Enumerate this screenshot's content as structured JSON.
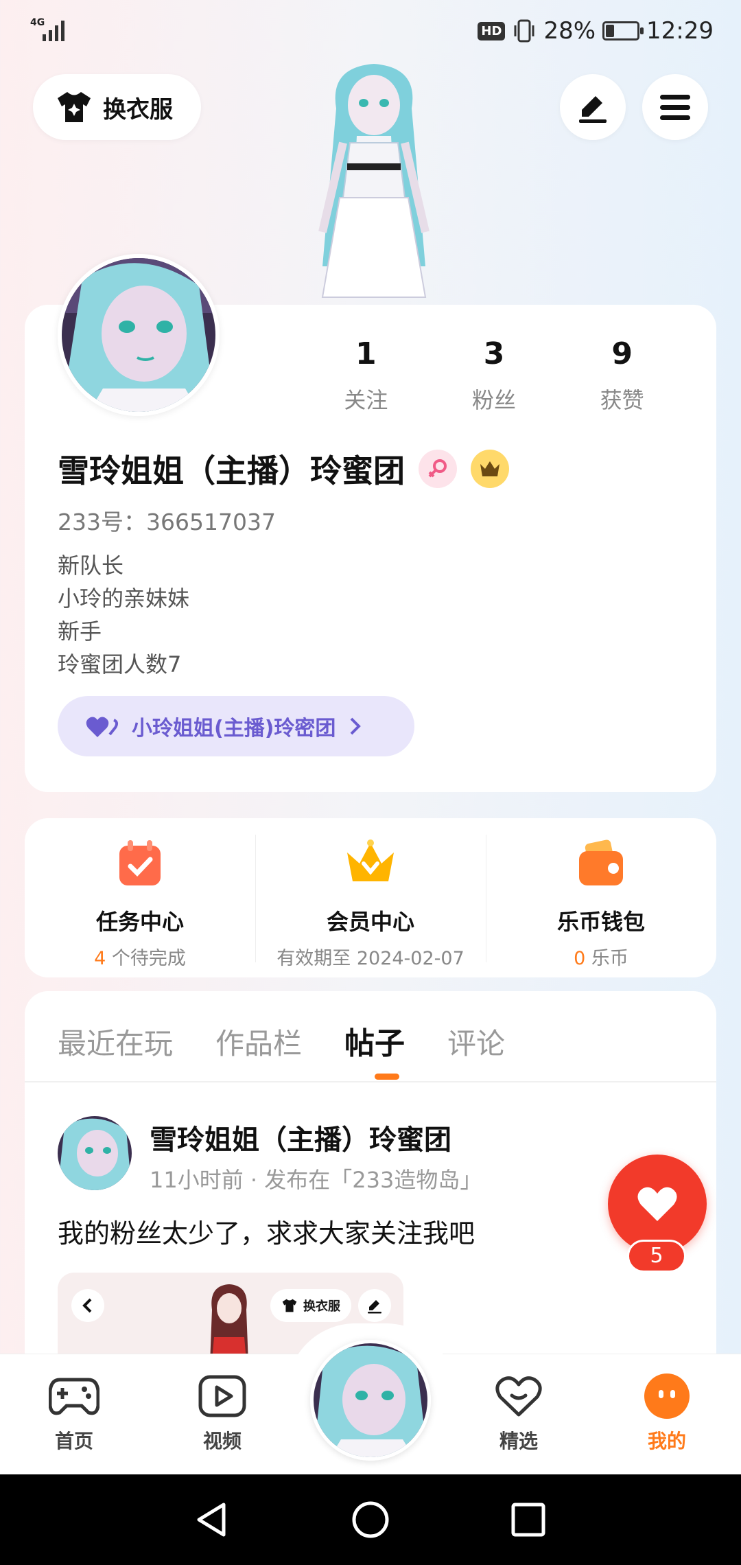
{
  "status_bar": {
    "network": "4G",
    "hd": "HD",
    "battery_text": "28%",
    "battery_level": 0.28,
    "time": "12:29"
  },
  "header": {
    "outfit_label": "换衣服",
    "outfit_icon": "tshirt-sparkle-icon",
    "edit_icon": "pen-icon",
    "menu_icon": "hamburger-menu-icon"
  },
  "profile": {
    "stats": [
      {
        "num": "1",
        "label": "关注"
      },
      {
        "num": "3",
        "label": "粉丝"
      },
      {
        "num": "9",
        "label": "获赞"
      }
    ],
    "name": "雪玲姐姐（主播）玲蜜团",
    "gender_icon": "female-icon",
    "crown_icon": "crown-badge-icon",
    "uid": "233号：366517037",
    "bio": [
      "新队长",
      "小玲的亲妹妹",
      "新手",
      "玲蜜团人数7"
    ],
    "group_label": "小玲姐姐(主播)玲密团",
    "accent": "#6a5bd0"
  },
  "services": [
    {
      "title": "任务中心",
      "count": "4",
      "sub": " 个待完成",
      "icon": "calendar-check-icon"
    },
    {
      "title": "会员中心",
      "count": "",
      "sub": "有效期至 2024-02-07",
      "icon": "crown-icon"
    },
    {
      "title": "乐币钱包",
      "count": "0",
      "sub": " 乐币",
      "icon": "wallet-icon"
    }
  ],
  "tabs": [
    {
      "label": "最近在玩",
      "active": false
    },
    {
      "label": "作品栏",
      "active": false
    },
    {
      "label": "帖子",
      "active": true
    },
    {
      "label": "评论",
      "active": false
    }
  ],
  "post": {
    "author": "雪玲姐姐（主播）玲蜜团",
    "meta": "11小时前 · 发布在「233造物岛」",
    "text": "我的粉丝太少了，求求大家关注我吧",
    "preview_outfit_label": "换衣服"
  },
  "like": {
    "count": "5"
  },
  "bottom_nav": [
    {
      "label": "首页",
      "icon": "gamepad-icon"
    },
    {
      "label": "视频",
      "icon": "play-icon"
    },
    {
      "label": "精选",
      "icon": "heart-icon"
    },
    {
      "label": "我的",
      "icon": "profile-face-icon",
      "active": true
    }
  ],
  "colors": {
    "orange": "#ff7a1a",
    "red": "#f23a2a"
  }
}
